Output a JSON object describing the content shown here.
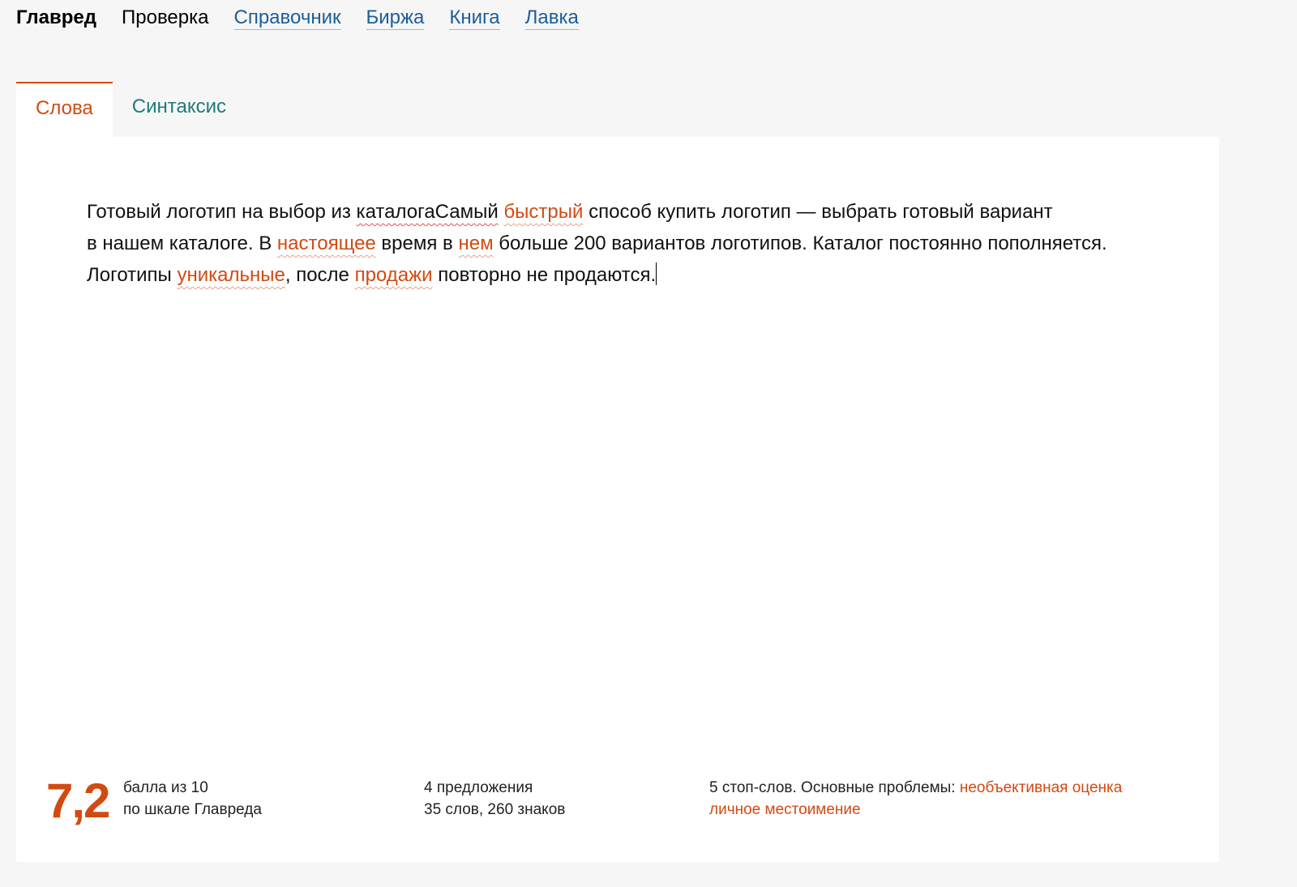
{
  "nav": {
    "brand": "Главред",
    "check": "Проверка",
    "reference": "Справочник",
    "exchange": "Биржа",
    "book": "Книга",
    "shop": "Лавка"
  },
  "tabs": {
    "words": "Слова",
    "syntax": "Синтаксис"
  },
  "editor": {
    "s1_a": "Готовый логотип на выбор из ",
    "s1_typo": "каталогаСамый",
    "s1_sp": " ",
    "s1_hl": "быстрый",
    "s1_b": " способ купить логотип — выбрать готовый вариант",
    "s2_a": "в нашем каталоге. В ",
    "s2_hl1": "настоящее",
    "s2_b": " время в ",
    "s2_hl2": "нем",
    "s2_c": " больше 200 вариантов логотипов. Каталог постоянно пополняется.",
    "s3_a": "Логотипы ",
    "s3_hl1": "уникальные",
    "s3_b": ", после ",
    "s3_hl2": "продажи",
    "s3_c": " повторно не продаются."
  },
  "stats": {
    "score": "7,2",
    "score_line1": "балла из 10",
    "score_line2": "по шкале Главреда",
    "sentences": "4 предложения",
    "words_chars": "35 слов, 260 знаков",
    "stopwords_label": "5 стоп-слов. Основные проблемы: ",
    "problem1": "необъективная оценка",
    "problem2": "личное местоимение"
  },
  "colors": {
    "accent": "#d24a12",
    "link": "#1a5e9c",
    "tab_inactive": "#1f7a7a"
  }
}
